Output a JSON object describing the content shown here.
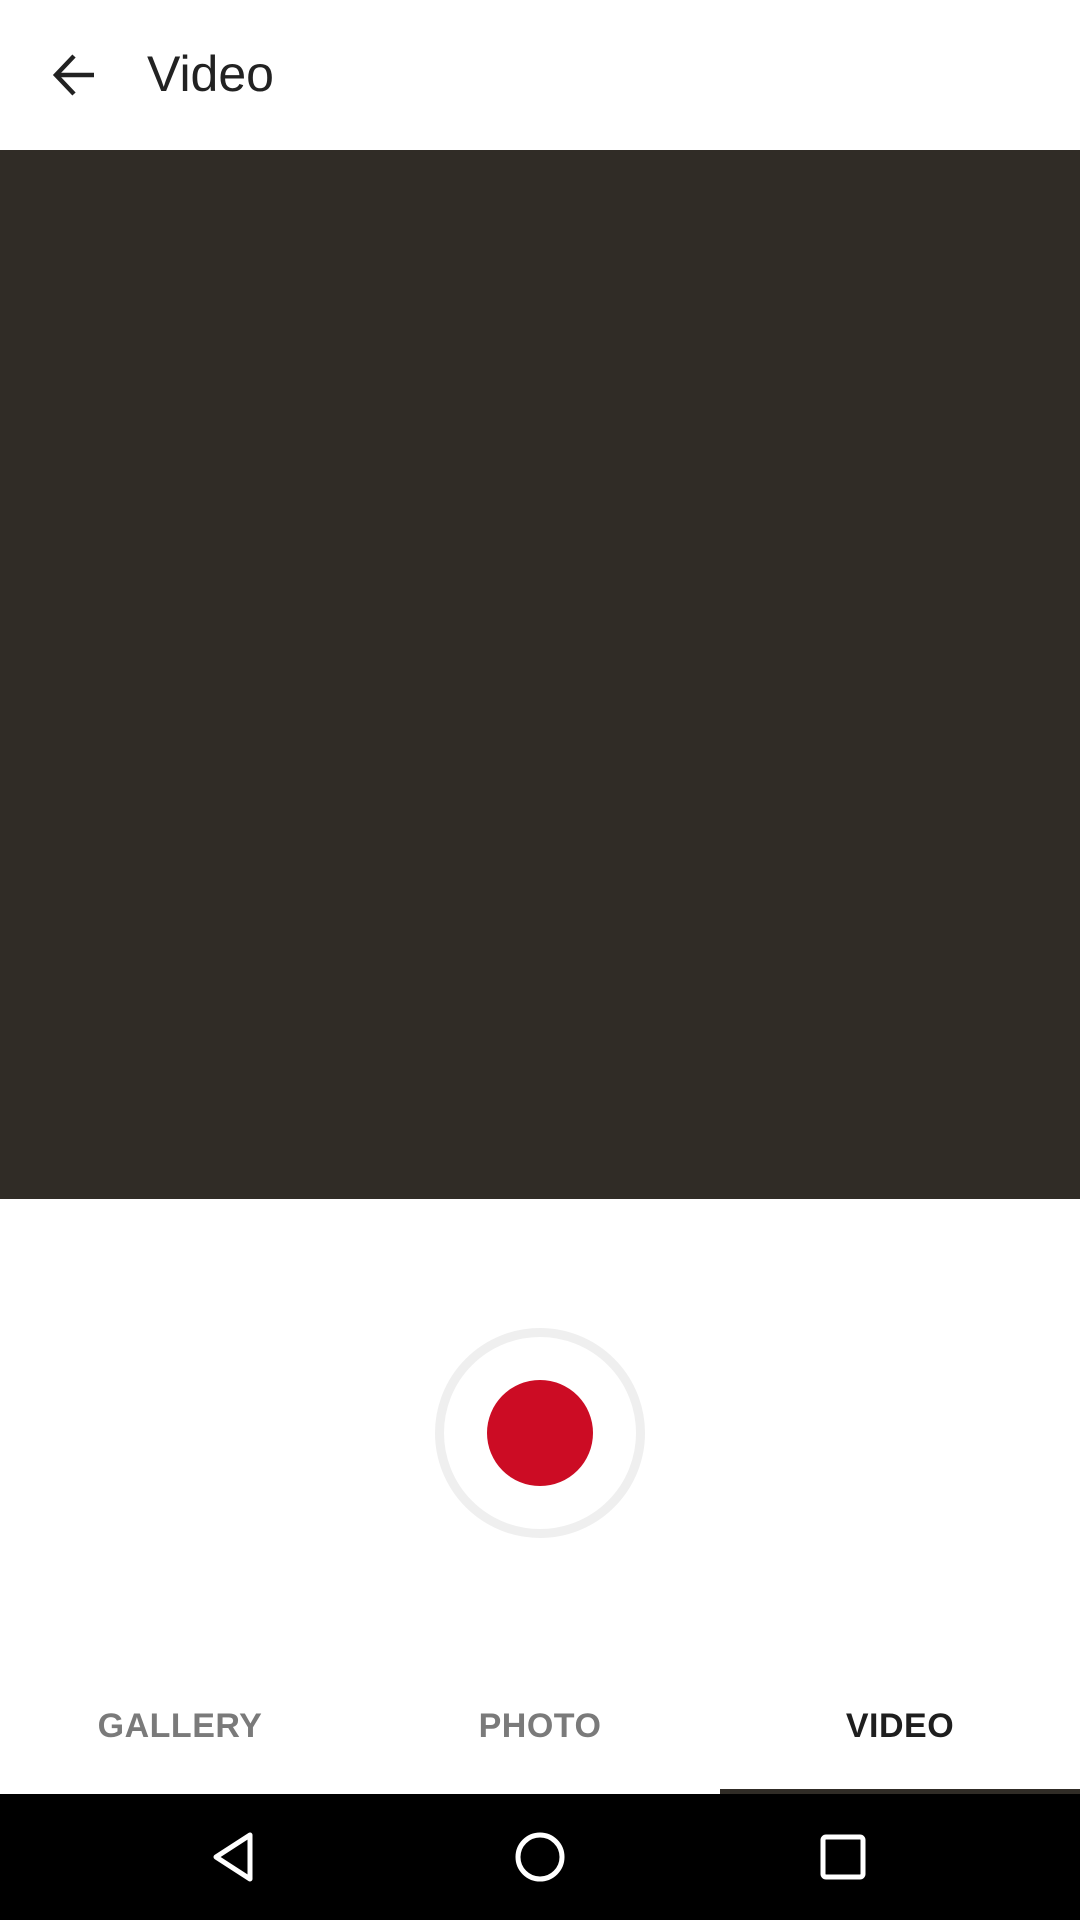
{
  "app_bar": {
    "title": "Video",
    "back_icon": "arrow-left-icon"
  },
  "preview": {
    "background_color": "#302c26"
  },
  "record": {
    "icon": "record-icon",
    "accent_color": "#cc0c24"
  },
  "tabs": [
    {
      "label": "GALLERY",
      "active": false
    },
    {
      "label": "PHOTO",
      "active": false
    },
    {
      "label": "VIDEO",
      "active": true
    }
  ],
  "nav_bar": {
    "back_icon": "nav-back-icon",
    "home_icon": "nav-home-icon",
    "recents_icon": "nav-recents-icon"
  }
}
